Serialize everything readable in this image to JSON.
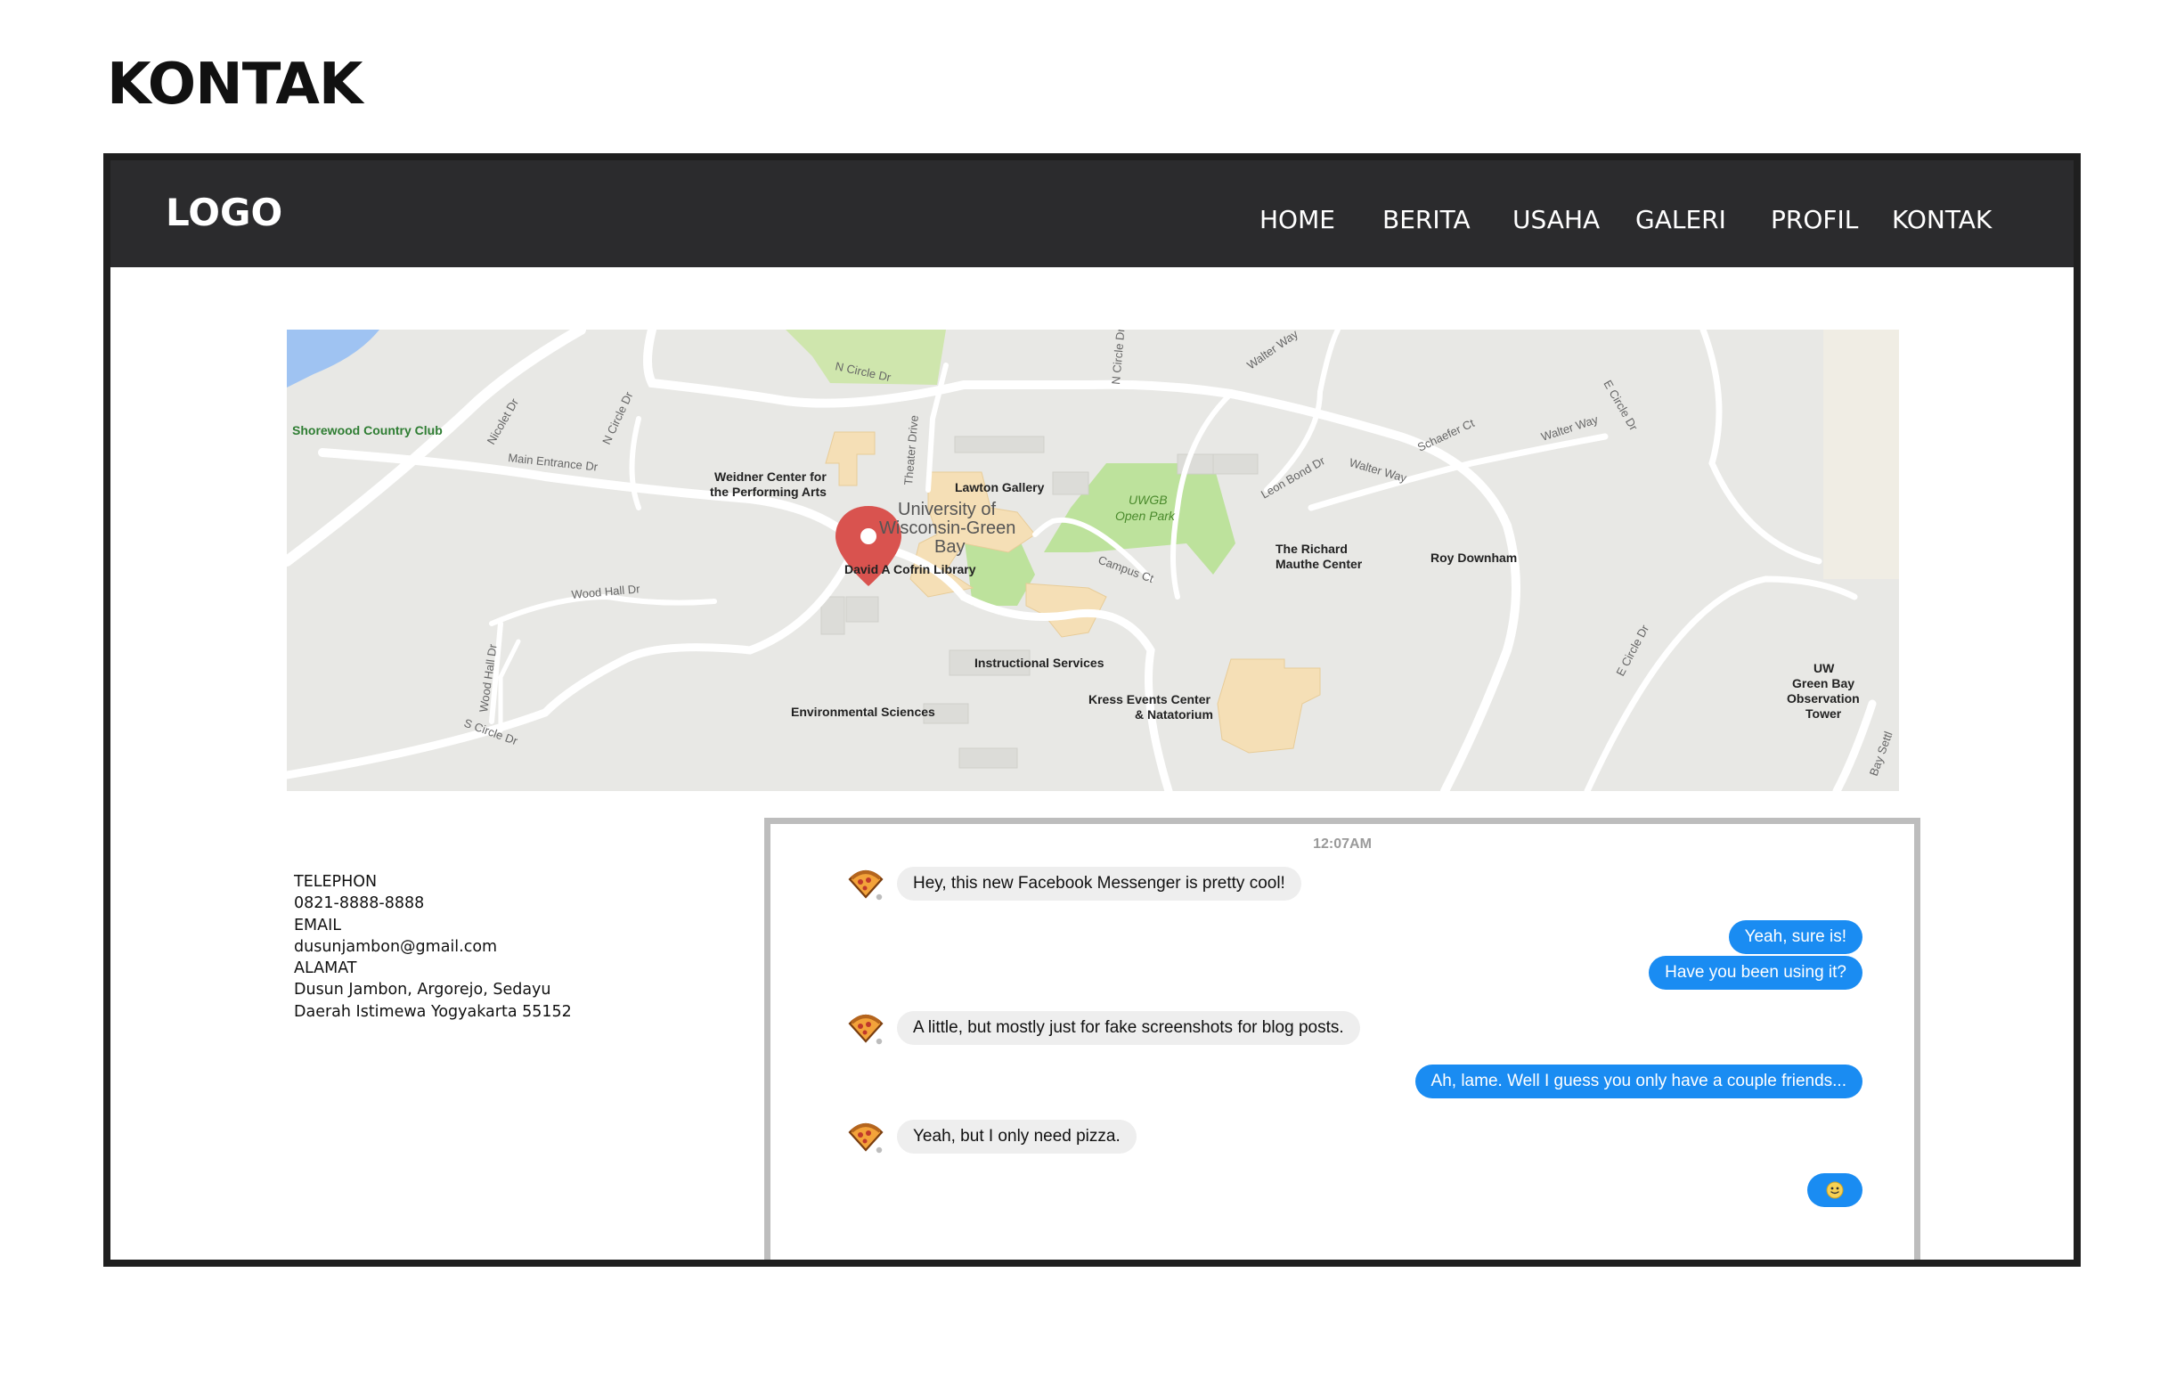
{
  "page": {
    "title": "KONTAK"
  },
  "navbar": {
    "logo": "LOGO",
    "items": [
      {
        "label": "HOME"
      },
      {
        "label": "BERITA"
      },
      {
        "label": "USAHA"
      },
      {
        "label": "GALERI"
      },
      {
        "label": "PROFIL"
      },
      {
        "label": "KONTAK"
      }
    ]
  },
  "map": {
    "labels": {
      "shorewood": "Shorewood Country Club",
      "weidner_1": "Weidner Center for",
      "weidner_2": "the Performing Arts",
      "lawton": "Lawton Gallery",
      "university_1": "University of",
      "university_2": "Wisconsin-Green",
      "university_3": "Bay",
      "library": "David A Cofrin Library",
      "open_park_1": "UWGB",
      "open_park_2": "Open Park",
      "richard_1": "The Richard",
      "richard_2": "Mauthe Center",
      "roy": "Roy Downham",
      "instructional": "Instructional Services",
      "environmental": "Environmental Sciences",
      "kress_1": "Kress Events Center",
      "kress_2": "& Natatorium",
      "tower_1": "UW",
      "tower_2": "Green Bay",
      "tower_3": "Observation",
      "tower_4": "Tower",
      "n_circle_dr": "N Circle Dr",
      "nicolet_dr": "Nicolet Dr",
      "main_entrance_dr": "Main Entrance Dr",
      "n_circle_dr_2": "N Circle Dr",
      "theater_drive": "Theater Drive",
      "n_circle_dr_3": "N Circle Dr",
      "walter_way": "Walter Way",
      "walter_way_2": "Walter Way",
      "walter_way_3": "Walter Way",
      "schaefer_ct": "Schaefer Ct",
      "leon_bond_dr": "Leon Bond Dr",
      "e_circle_dr": "E Circle Dr",
      "e_circle_dr_2": "E Circle Dr",
      "campus_ct": "Campus Ct",
      "wood_hall_dr": "Wood Hall Dr",
      "wood_hall_dr_2": "Wood Hall Dr",
      "s_circle_dr": "S Circle Dr",
      "bay_settlement": "Bay Settl"
    }
  },
  "contact": {
    "telephone_label": "TELEPHON",
    "telephone": "0821-8888-8888",
    "email_label": "EMAIL",
    "email": "dusunjambon@gmail.com",
    "address_label": "ALAMAT",
    "address_line1": "Dusun Jambon, Argorejo, Sedayu",
    "address_line2": "Daerah Istimewa Yogyakarta 55152"
  },
  "chat": {
    "timestamp": "12:07AM",
    "messages": [
      {
        "text": "Hey, this new Facebook Messenger is pretty cool!"
      },
      {
        "text": "Yeah, sure is!"
      },
      {
        "text": "Have you been using it?"
      },
      {
        "text": "A little, but mostly just for fake screenshots for blog posts."
      },
      {
        "text": "Ah, lame. Well I guess you only have a couple friends..."
      },
      {
        "text": "Yeah, but I only need pizza."
      }
    ],
    "emoji_icon": "smiley-icon"
  },
  "colors": {
    "navbar": "#2b2b2d",
    "outgoing_bubble": "#1a8cf2",
    "incoming_bubble": "#eeeeee",
    "map_pin": "#d9534f"
  }
}
